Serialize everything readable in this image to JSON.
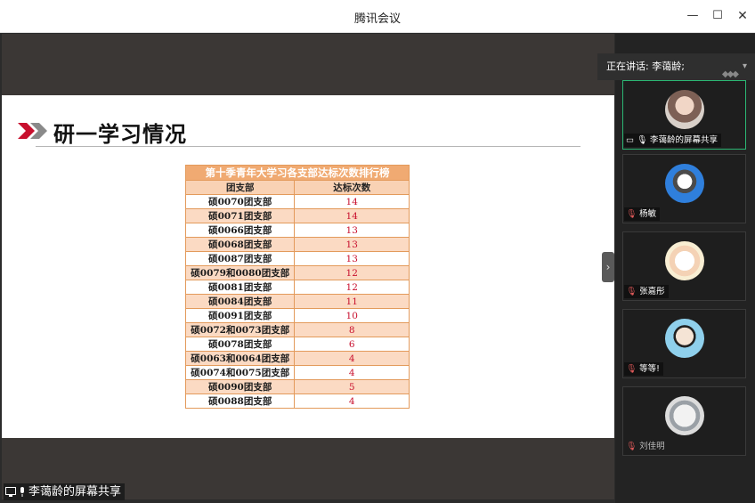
{
  "window": {
    "title": "腾讯会议"
  },
  "slide": {
    "title": "研一学习情况",
    "table": {
      "caption": "第十季青年大学习各支部达标次数排行榜",
      "headers": [
        "团支部",
        "达标次数"
      ],
      "rows": [
        {
          "name": "硕0070团支部",
          "count": "14"
        },
        {
          "name": "硕0071团支部",
          "count": "14"
        },
        {
          "name": "硕0066团支部",
          "count": "13"
        },
        {
          "name": "硕0068团支部",
          "count": "13"
        },
        {
          "name": "硕0087团支部",
          "count": "13"
        },
        {
          "name": "硕0079和0080团支部",
          "count": "12"
        },
        {
          "name": "硕0081团支部",
          "count": "12"
        },
        {
          "name": "硕0084团支部",
          "count": "11"
        },
        {
          "name": "硕0091团支部",
          "count": "10"
        },
        {
          "name": "硕0072和0073团支部",
          "count": "8"
        },
        {
          "name": "硕0078团支部",
          "count": "6"
        },
        {
          "name": "硕0063和0064团支部",
          "count": "4"
        },
        {
          "name": "硕0074和0075团支部",
          "count": "4"
        },
        {
          "name": "硕0090团支部",
          "count": "5"
        },
        {
          "name": "硕0088团支部",
          "count": "4"
        }
      ]
    }
  },
  "share_label": "李蔼龄的屏幕共享",
  "speaking": "正在讲话: 李蔼龄;",
  "participants": [
    {
      "name": "李蔼龄的屏幕共享",
      "avatar_icon": "woman-with-glasses-avatar"
    },
    {
      "name": "杨敏",
      "avatar_icon": "anime-character-avatar"
    },
    {
      "name": "张嘉彤",
      "avatar_icon": "cartoon-cat-avatar"
    },
    {
      "name": "等等!",
      "avatar_icon": "crayon-shin-chan-avatar"
    },
    {
      "name": "刘佳明",
      "avatar_icon": "bird-avatar"
    }
  ],
  "colors": {
    "table_caption": "#f0aa72",
    "table_band": "#fbdac3",
    "count_text": "#c8102e",
    "active_tile_border": "#2bb673"
  }
}
